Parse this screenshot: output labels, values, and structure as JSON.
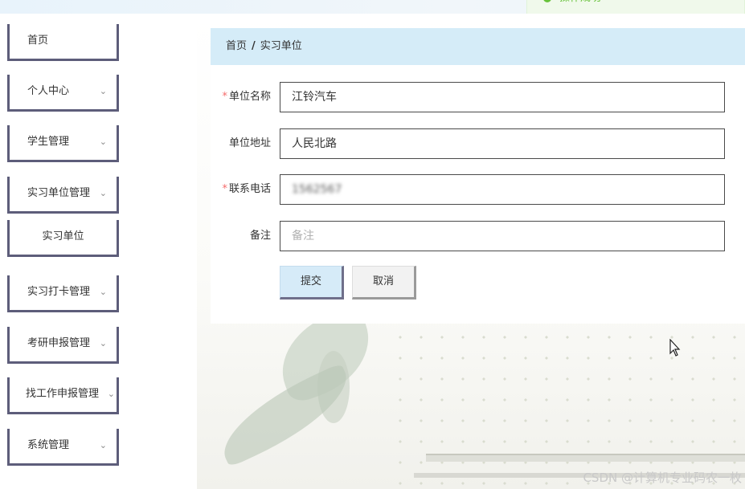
{
  "toast": {
    "text": "操作成功",
    "color": "#67c23a"
  },
  "sidebar": {
    "items": [
      {
        "label": "首页",
        "has_chevron": false
      },
      {
        "label": "个人中心",
        "has_chevron": true
      },
      {
        "label": "学生管理",
        "has_chevron": true
      },
      {
        "label": "实习单位管理",
        "has_chevron": true
      },
      {
        "label": "实习单位",
        "has_chevron": false,
        "sub": true
      },
      {
        "label": "实习打卡管理",
        "has_chevron": true
      },
      {
        "label": "考研申报管理",
        "has_chevron": true
      },
      {
        "label": "找工作申报管理",
        "has_chevron": true
      },
      {
        "label": "系统管理",
        "has_chevron": true
      }
    ],
    "chevron": "⌄"
  },
  "breadcrumb": {
    "home": "首页",
    "separator": "/",
    "current": "实习单位"
  },
  "form": {
    "fields": [
      {
        "label": "单位名称",
        "required": true,
        "value": "江铃汽车",
        "placeholder": ""
      },
      {
        "label": "单位地址",
        "required": false,
        "value": "人民北路",
        "placeholder": ""
      },
      {
        "label": "联系电话",
        "required": true,
        "value": "1562567",
        "placeholder": ""
      },
      {
        "label": "备注",
        "required": false,
        "value": "",
        "placeholder": "备注"
      }
    ],
    "required_mark": "*",
    "submit_label": "提交",
    "cancel_label": "取消"
  },
  "watermark": "CSDN @计算机专业码农一枚",
  "colors": {
    "breadcrumb_bg": "#d5ecf8",
    "submit_bg": "#d6ebf8",
    "required": "#f56c6c",
    "menu_border": "#5d5d7a"
  }
}
